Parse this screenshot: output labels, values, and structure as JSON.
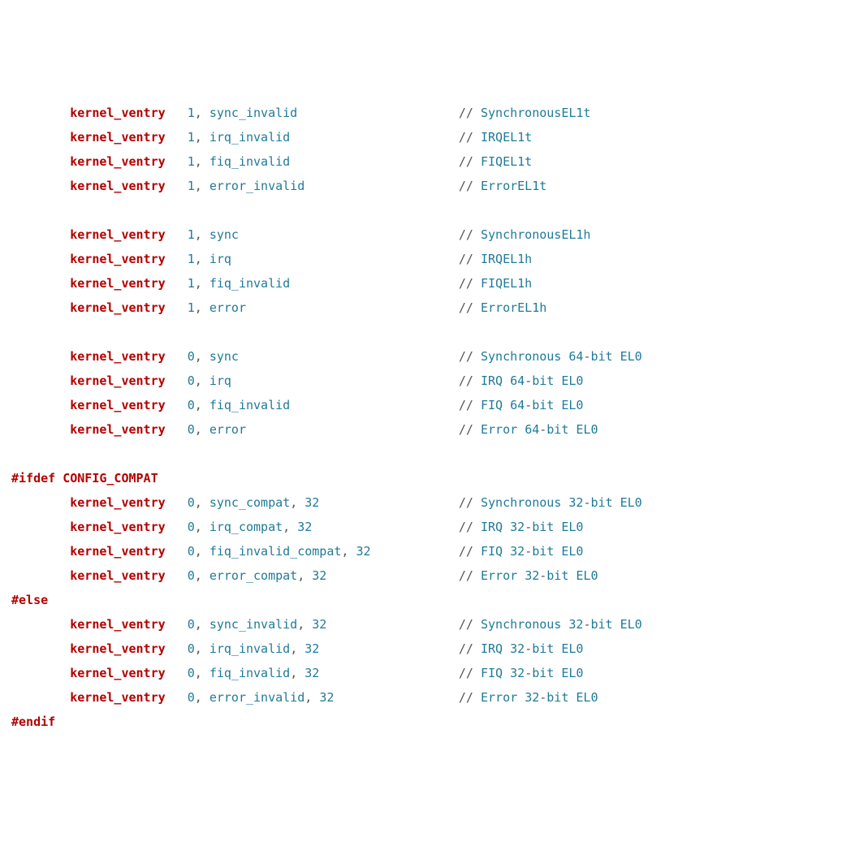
{
  "indent": "        ",
  "xindent": "       ",
  "label": "kernel_ventry",
  "col_args": "   ",
  "pun": {
    "comma": ",",
    "slash": "// ",
    "dash": "-"
  },
  "rows": [
    {
      "num": "1",
      "handler": "sync_invalid",
      "bits": "",
      "pad": "                      ",
      "prefix": "Synchronous",
      "mid": " ",
      "suffix": "EL1t"
    },
    {
      "num": "1",
      "handler": "irq_invalid",
      "bits": "",
      "pad": "                       ",
      "prefix": "IRQ",
      "mid": " ",
      "suffix": "EL1t"
    },
    {
      "num": "1",
      "handler": "fiq_invalid",
      "bits": "",
      "pad": "                       ",
      "prefix": "FIQ",
      "mid": " ",
      "suffix": "EL1t"
    },
    {
      "num": "1",
      "handler": "error_invalid",
      "bits": "",
      "pad": "                     ",
      "prefix": "Error",
      "mid": " ",
      "suffix": "EL1t"
    },
    {
      "blank": true
    },
    {
      "num": "1",
      "handler": "sync",
      "bits": "",
      "pad": "                              ",
      "prefix": "Synchronous",
      "mid": " ",
      "suffix": "EL1h"
    },
    {
      "num": "1",
      "handler": "irq",
      "bits": "",
      "pad": "                               ",
      "prefix": "IRQ",
      "mid": " ",
      "suffix": "EL1h"
    },
    {
      "num": "1",
      "handler": "fiq_invalid",
      "bits": "",
      "pad": "                       ",
      "prefix": "FIQ",
      "mid": " ",
      "suffix": "EL1h"
    },
    {
      "num": "1",
      "handler": "error",
      "bits": "",
      "pad": "                             ",
      "prefix": "Error",
      "mid": " ",
      "suffix": "EL1h"
    },
    {
      "blank": true
    },
    {
      "num": "0",
      "handler": "sync",
      "bits": "",
      "pad": "                              ",
      "prefix": "Synchronous ",
      "bw": "64",
      "suffix": "bit EL0"
    },
    {
      "num": "0",
      "handler": "irq",
      "bits": "",
      "pad": "                               ",
      "prefix": "IRQ ",
      "bw": "64",
      "suffix": "bit EL0"
    },
    {
      "num": "0",
      "handler": "fiq_invalid",
      "bits": "",
      "pad": "                       ",
      "prefix": "FIQ ",
      "bw": "64",
      "suffix": "bit EL0"
    },
    {
      "num": "0",
      "handler": "error",
      "bits": "",
      "pad": "                             ",
      "prefix": "Error ",
      "bw": "64",
      "suffix": "bit EL0"
    },
    {
      "blank": true
    },
    {
      "directive": "#ifdef",
      "dirarg": "CONFIG_COMPAT"
    },
    {
      "num": "0",
      "handler": "sync_compat",
      "bits": "32",
      "pad": "                   ",
      "prefix": "Synchronous ",
      "bw": "32",
      "suffix": "bit EL0"
    },
    {
      "num": "0",
      "handler": "irq_compat",
      "bits": "32",
      "pad": "                    ",
      "prefix": "IRQ ",
      "bw": "32",
      "suffix": "bit EL0"
    },
    {
      "num": "0",
      "handler": "fiq_invalid_compat",
      "bits": "32",
      "pad": "            ",
      "prefix": "FIQ ",
      "bw": "32",
      "suffix": "bit EL0"
    },
    {
      "num": "0",
      "handler": "error_compat",
      "bits": "32",
      "pad": "                  ",
      "prefix": "Error ",
      "bw": "32",
      "suffix": "bit EL0"
    },
    {
      "directive": "#else"
    },
    {
      "num": "0",
      "handler": "sync_invalid",
      "bits": "32",
      "pad": "                  ",
      "prefix": "Synchronous ",
      "bw": "32",
      "suffix": "bit EL0"
    },
    {
      "num": "0",
      "handler": "irq_invalid",
      "bits": "32",
      "pad": "                   ",
      "prefix": "IRQ ",
      "bw": "32",
      "suffix": "bit EL0"
    },
    {
      "num": "0",
      "handler": "fiq_invalid",
      "bits": "32",
      "pad": "                   ",
      "prefix": "FIQ ",
      "bw": "32",
      "suffix": "bit EL0"
    },
    {
      "num": "0",
      "handler": "error_invalid",
      "bits": "32",
      "pad": "                 ",
      "prefix": "Error ",
      "bw": "32",
      "suffix": "bit EL0"
    },
    {
      "directive": "#endif"
    }
  ]
}
